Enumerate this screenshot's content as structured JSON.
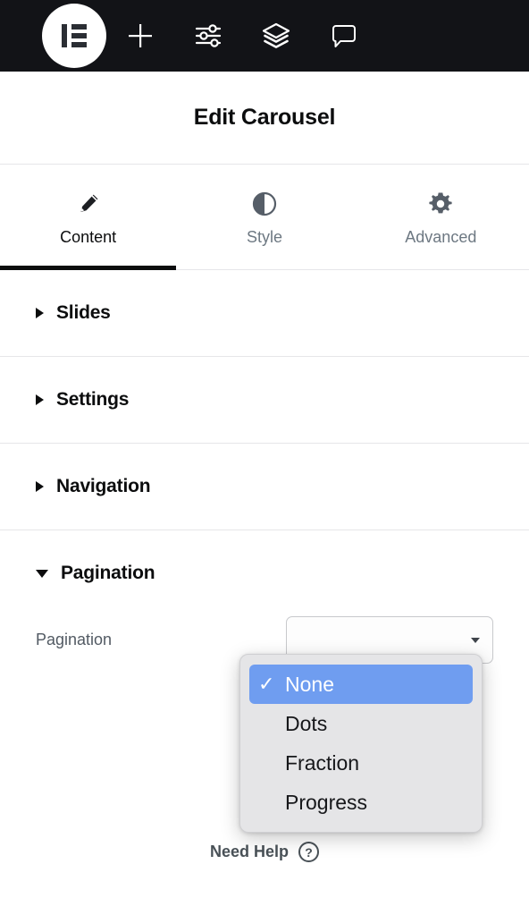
{
  "toolbar": {
    "logo": {
      "name": "elementor-logo",
      "label": "Elementor"
    },
    "buttons": [
      {
        "name": "add-element-button",
        "icon": "plus-icon",
        "label": "Add Element"
      },
      {
        "name": "settings-button",
        "icon": "sliders-icon",
        "label": "Settings"
      },
      {
        "name": "navigator-button",
        "icon": "layers-icon",
        "label": "Navigator"
      },
      {
        "name": "feedback-button",
        "icon": "chat-bubble-icon",
        "label": "Feedback"
      }
    ]
  },
  "header": {
    "title": "Edit Carousel"
  },
  "tabs": [
    {
      "label": "Content",
      "icon": "pencil-icon",
      "active": true
    },
    {
      "label": "Style",
      "icon": "contrast-icon",
      "active": false
    },
    {
      "label": "Advanced",
      "icon": "gear-icon",
      "active": false
    }
  ],
  "sections": [
    {
      "title": "Slides",
      "open": false
    },
    {
      "title": "Settings",
      "open": false
    },
    {
      "title": "Navigation",
      "open": false
    },
    {
      "title": "Pagination",
      "open": true
    }
  ],
  "pagination_section": {
    "control_label": "Pagination",
    "select_value": ""
  },
  "dropdown": {
    "open": true,
    "selected_index": 0,
    "check_glyph": "✓",
    "options": [
      {
        "label": "None",
        "selected": true
      },
      {
        "label": "Dots",
        "selected": false
      },
      {
        "label": "Fraction",
        "selected": false
      },
      {
        "label": "Progress",
        "selected": false
      }
    ]
  },
  "footer": {
    "need_help_label": "Need Help",
    "help_glyph": "?"
  },
  "colors": {
    "toolbar_bg": "#121317",
    "accent_selected": "#6f9df0",
    "text_primary": "#0c0d0e",
    "text_muted": "#6d7882",
    "divider": "#e6e6e9",
    "dropdown_bg": "#e5e5e7"
  }
}
